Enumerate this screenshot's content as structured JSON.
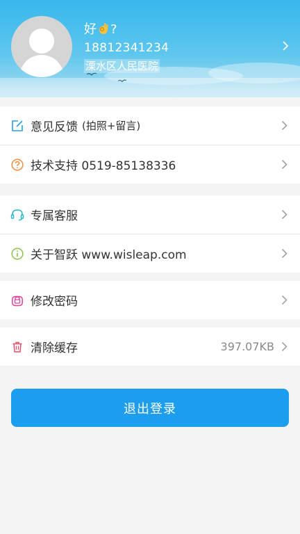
{
  "profile": {
    "name_text": "好",
    "name_suffix": "?",
    "phone": "18812341234",
    "organization": "溧水区人民医院"
  },
  "menu_groups": [
    {
      "items": [
        {
          "label": "意见反馈",
          "sub": "(拍照+留言)",
          "icon": "edit-icon",
          "color": "#2a9fe0"
        },
        {
          "label": "技术支持 0519-85138336",
          "icon": "question-icon",
          "color": "#f08a3c"
        }
      ]
    },
    {
      "items": [
        {
          "label": "专属客服",
          "icon": "headset-icon",
          "color": "#2ab8c8"
        },
        {
          "label": "关于智跃 www.wisleap.com",
          "icon": "info-icon",
          "color": "#8bc34a"
        }
      ]
    },
    {
      "items": [
        {
          "label": "修改密码",
          "icon": "lock-icon",
          "color": "#e0409b"
        }
      ]
    },
    {
      "items": [
        {
          "label": "清除缓存",
          "value": "397.07KB",
          "icon": "trash-icon",
          "color": "#e8506a"
        }
      ]
    }
  ],
  "logout_label": "退出登录",
  "colors": {
    "header_top": "#37b8ec",
    "accent": "#1c9ded",
    "background": "#f4f4f4"
  }
}
